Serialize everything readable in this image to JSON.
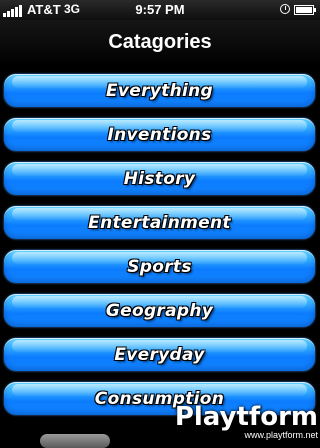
{
  "status_bar": {
    "carrier": "AT&T",
    "network": "3G",
    "time": "9:57 PM",
    "icons": [
      "signal-icon",
      "clock-icon",
      "battery-icon"
    ]
  },
  "nav": {
    "title": "Catagories"
  },
  "categories": [
    {
      "label": "Everything"
    },
    {
      "label": "Inventions"
    },
    {
      "label": "History"
    },
    {
      "label": "Entertainment"
    },
    {
      "label": "Sports"
    },
    {
      "label": "Geography"
    },
    {
      "label": "Everyday"
    },
    {
      "label": "Consumption"
    }
  ],
  "watermark": {
    "logo": "Playtform",
    "url": "www.playtform.net"
  },
  "colors": {
    "button_top": "#6ad8ff",
    "button_bottom": "#0c7cff",
    "background": "#000000"
  }
}
